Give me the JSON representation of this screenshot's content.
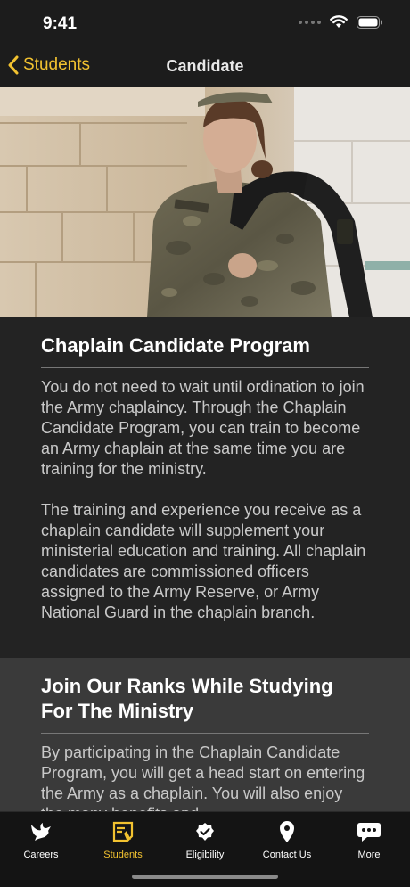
{
  "status_bar": {
    "time": "9:41"
  },
  "nav": {
    "back_label": "Students",
    "title": "Candidate"
  },
  "hero": {
    "alt": "Army chaplain candidate in uniform with backpack"
  },
  "section1": {
    "title": "Chaplain Candidate Program",
    "paragraphs": [
      "You do not need to wait until ordination to join the Army chaplaincy. Through the Chaplain Candidate Program, you can train to become an Army chaplain at the same time you are training for the ministry.",
      "The training and experience you receive as a chaplain candidate will supplement your ministerial education and training. All chaplain candidates are commissioned officers assigned to the Army Reserve, or Army National Guard in the chaplain branch."
    ]
  },
  "section2": {
    "title": "Join Our Ranks While Studying For The Ministry",
    "body": "By participating in the Chaplain Candidate Program, you will get a head start on entering the Army as a chaplain. You will also enjoy the many benefits and"
  },
  "tabs": [
    {
      "label": "Careers",
      "icon": "dove-icon",
      "active": false
    },
    {
      "label": "Students",
      "icon": "certificate-icon",
      "active": true
    },
    {
      "label": "Eligibility",
      "icon": "checkmark-badge-icon",
      "active": false
    },
    {
      "label": "Contact Us",
      "icon": "location-pin-icon",
      "active": false
    },
    {
      "label": "More",
      "icon": "chat-dots-icon",
      "active": false
    }
  ],
  "colors": {
    "accent": "#f2c230",
    "background": "#232323",
    "section_alt": "#3a3a3a"
  }
}
